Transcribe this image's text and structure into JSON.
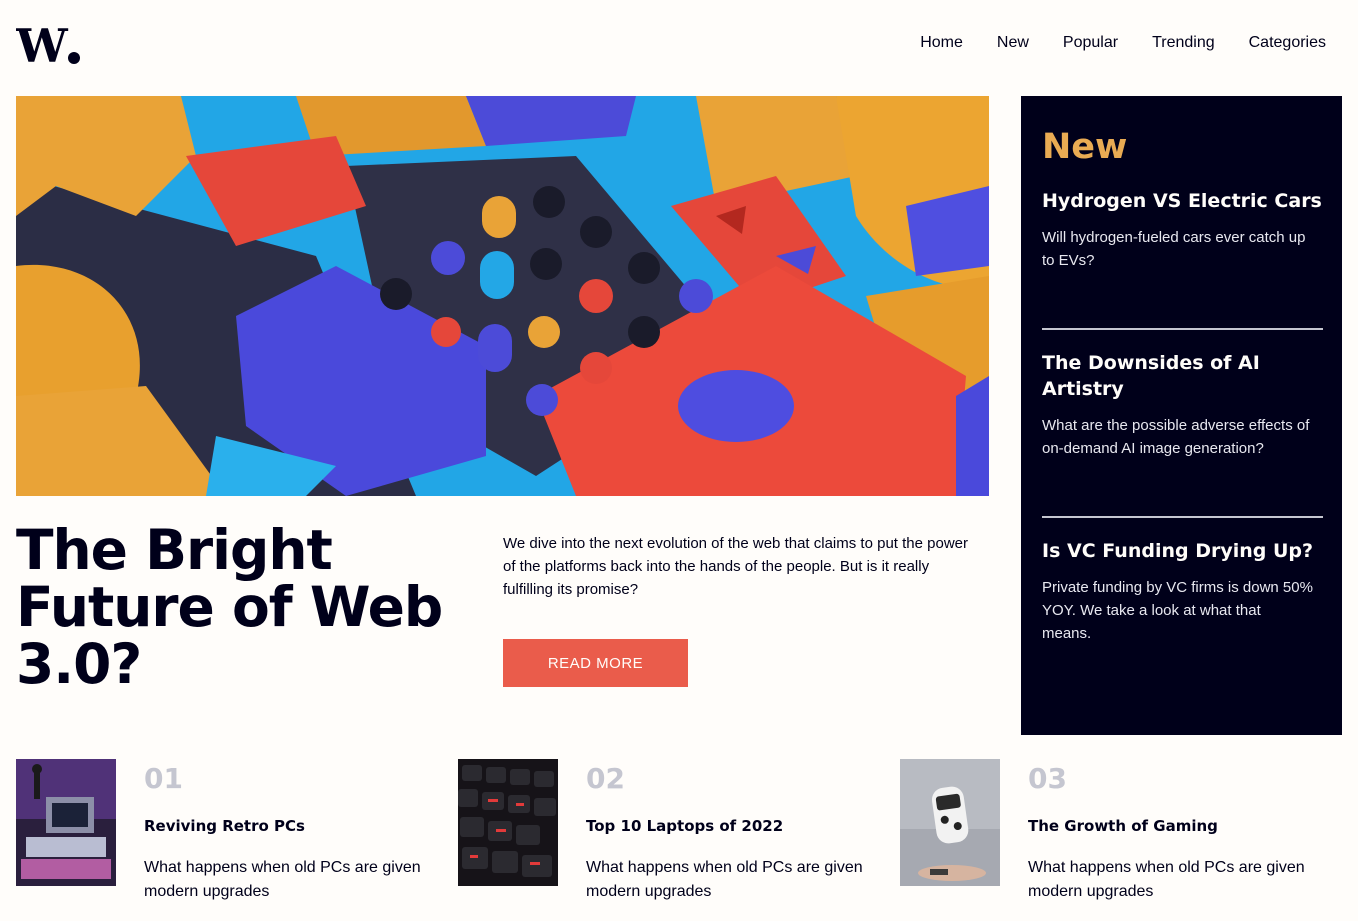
{
  "header": {
    "logo_text": "W.",
    "nav": [
      "Home",
      "New",
      "Popular",
      "Trending",
      "Categories"
    ]
  },
  "hero": {
    "title": "The Bright Future of Web 3.0?",
    "description": "We dive into the next evolution of the web that claims to put the power of the platforms back into the hands of the people. But is it really fulfilling its promise?",
    "button_label": "READ MORE"
  },
  "new_panel": {
    "heading": "New",
    "items": [
      {
        "title": "Hydrogen VS Electric Cars",
        "description": "Will hydrogen-fueled cars ever catch up to EVs?"
      },
      {
        "title": "The Downsides of AI Artistry",
        "description": "What are the possible adverse effects of on-demand AI image generation?"
      },
      {
        "title": "Is VC Funding Drying Up?",
        "description": "Private funding by VC firms is down 50% YOY. We take a look at what that means."
      }
    ]
  },
  "cards": [
    {
      "number": "01",
      "title": "Reviving Retro PCs",
      "description": "What happens when old PCs are given modern upgrades"
    },
    {
      "number": "02",
      "title": "Top 10 Laptops of 2022",
      "description": "What happens when old PCs are given modern upgrades"
    },
    {
      "number": "03",
      "title": "The Growth of Gaming",
      "description": "What happens when old PCs are given modern upgrades"
    }
  ],
  "colors": {
    "primary_dark": "#00001a",
    "accent_orange": "#e9ab53",
    "accent_red": "#ea5c4b",
    "muted_gray": "#c5c6d0",
    "background": "#fffdfa"
  }
}
